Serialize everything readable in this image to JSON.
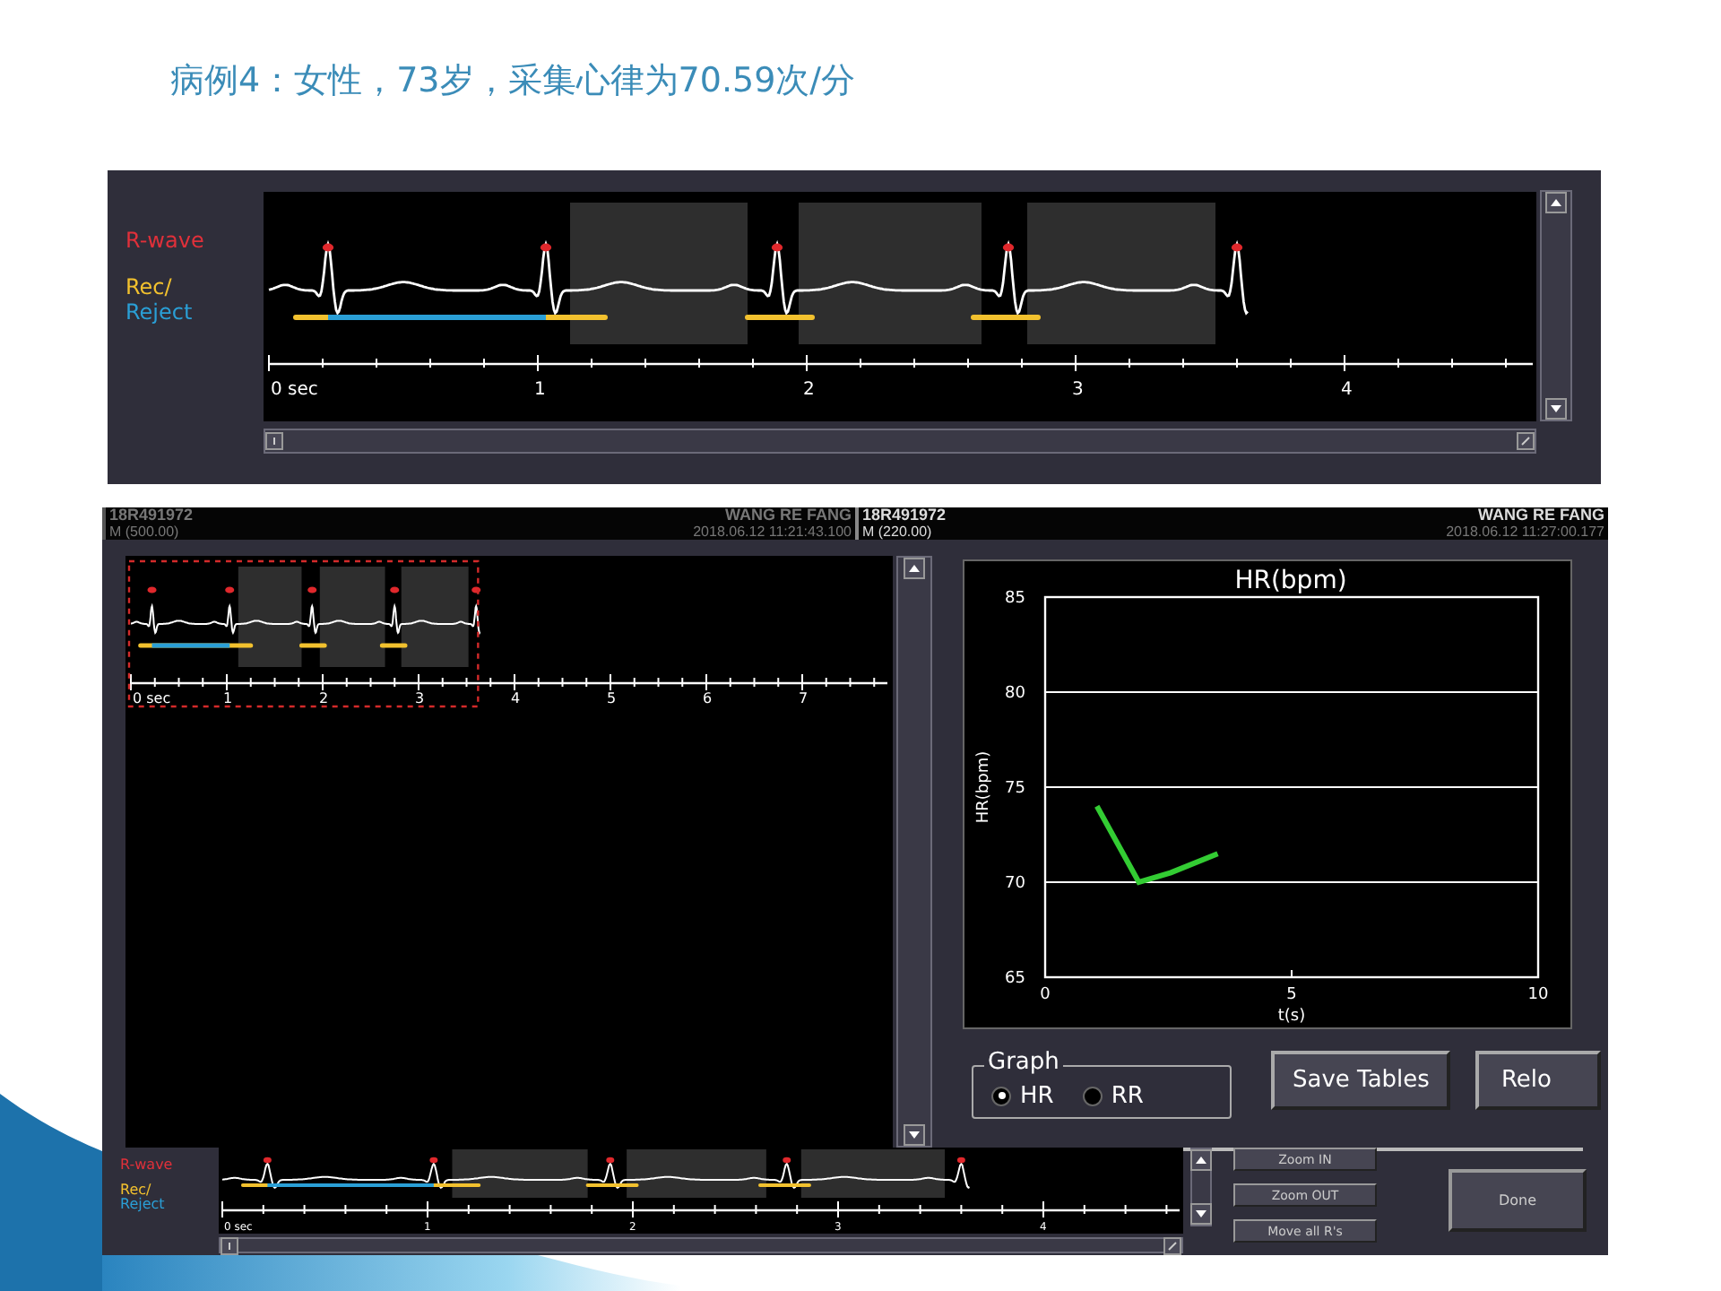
{
  "title": "病例4：女性，73岁，采集心律为70.59次/分",
  "top_panel": {
    "legend": {
      "r_wave": "R-wave",
      "rec": "Rec/",
      "reject": "Reject"
    },
    "axis_labels": [
      "0 sec",
      "1",
      "2",
      "3",
      "4"
    ]
  },
  "main_window": {
    "headers": [
      {
        "record_id": "18R491972",
        "mode": "M (500.00)",
        "patient": "WANG RE FANG",
        "timestamp": "2018.06.12 11:21:43.100"
      },
      {
        "record_id": "18R491972",
        "mode": "M (220.00)",
        "patient": "WANG RE FANG",
        "timestamp": "2018.06.12 11:27:00.177"
      }
    ],
    "overview": {
      "axis_labels": [
        "0 sec",
        "1",
        "2",
        "3",
        "4",
        "5",
        "6",
        "7"
      ]
    },
    "hr_chart": {
      "chart_data": {
        "type": "line",
        "title": "HR(bpm)",
        "xlabel": "t(s)",
        "ylabel": "HR(bpm)",
        "x": [
          1.05,
          1.9,
          2.55,
          3.5
        ],
        "series": [
          {
            "color": "#33cc33",
            "values": [
              74,
              70,
              70.5,
              71.5
            ]
          }
        ],
        "grid": true,
        "xlim": [
          0,
          10
        ],
        "ylim": [
          65,
          85
        ],
        "xticks": [
          0,
          5,
          10
        ],
        "yticks": [
          65,
          70,
          75,
          80,
          85
        ]
      }
    },
    "graph_group": {
      "title": "Graph",
      "options": [
        {
          "label": "HR",
          "selected": true
        },
        {
          "label": "RR",
          "selected": false
        }
      ]
    },
    "buttons": [
      {
        "label": "Save Tables"
      },
      {
        "label": "Relo"
      }
    ],
    "strip": {
      "legend": {
        "r_wave": "R-wave",
        "rec": "Rec/",
        "reject": "Reject"
      },
      "axis_labels": [
        "0 sec",
        "1",
        "2",
        "3",
        "4"
      ]
    },
    "side_buttons": [
      {
        "label": "Zoom IN"
      },
      {
        "label": "Zoom OUT"
      },
      {
        "label": "Move all R's"
      }
    ],
    "done_button": {
      "label": "Done"
    }
  }
}
